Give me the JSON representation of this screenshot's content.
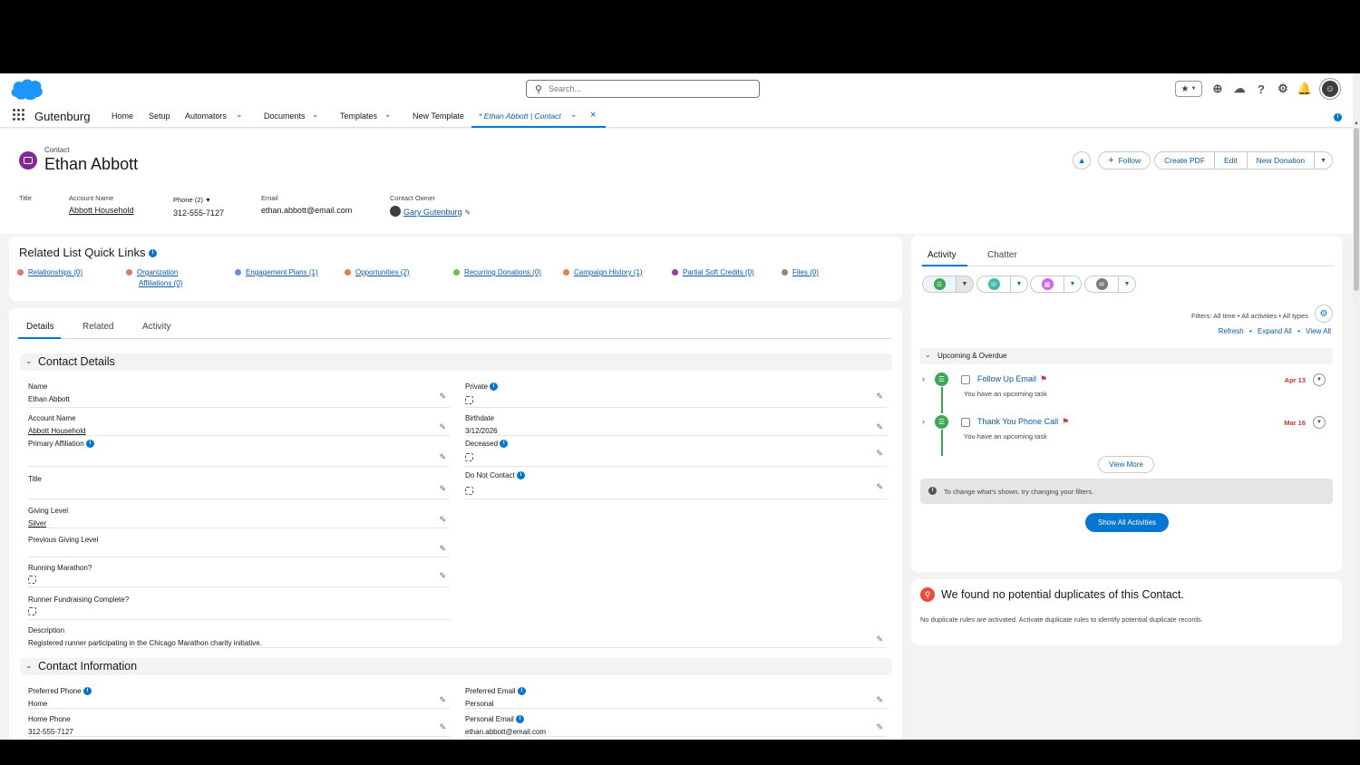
{
  "header": {
    "search_placeholder": "Search...",
    "icons": [
      "star-icon",
      "add-icon",
      "trailhead-icon",
      "help-icon",
      "setup-gear-icon",
      "bell-icon",
      "avatar-icon"
    ]
  },
  "nav": {
    "app_name": "Gutenburg",
    "items": [
      "Home",
      "Setup",
      "Automators",
      "Documents",
      "Templates",
      "New Template"
    ],
    "active_tab": "* Ethan Abbott | Contact"
  },
  "record": {
    "type": "Contact",
    "name": "Ethan Abbott",
    "buttons": {
      "follow": "Follow",
      "create_pdf": "Create PDF",
      "edit": "Edit",
      "new_donation": "New Donation"
    },
    "highlights": [
      {
        "label": "Title",
        "value": ""
      },
      {
        "label": "Account Name",
        "value": "Abbott Household"
      },
      {
        "label": "Phone (2)",
        "value": "312-555-7127"
      },
      {
        "label": "Email",
        "value": "ethan.abbott@email.com"
      },
      {
        "label": "Contact Owner",
        "value": "Gary Gutenburg"
      }
    ]
  },
  "quick_links": {
    "title": "Related List Quick Links",
    "links": [
      {
        "label": "Relationships (0)",
        "color": "#e8726b"
      },
      {
        "label": "Organization",
        "label2": "Affiliations (0)",
        "color": "#e8726b"
      },
      {
        "label": "Engagement Plans (1)",
        "color": "#6e8ad8"
      },
      {
        "label": "Opportunities (2)",
        "color": "#ec7a46"
      },
      {
        "label": "Recurring Donations (0)",
        "color": "#6cc04a"
      },
      {
        "label": "Campaign History (1)",
        "color": "#ec7a46"
      },
      {
        "label": "Partial Soft Credits (0)",
        "color": "#9b3aa8"
      },
      {
        "label": "Files (0)",
        "color": "#888888"
      }
    ]
  },
  "detail_tabs": [
    "Details",
    "Related",
    "Activity"
  ],
  "contact_details": {
    "title": "Contact Details",
    "left": [
      {
        "label": "Name",
        "value": "Ethan Abbott"
      },
      {
        "label": "Account Name",
        "value": "Abbott Household"
      },
      {
        "label": "Primary Affiliation",
        "value": ""
      },
      {
        "label": "Title",
        "value": ""
      },
      {
        "label": "Giving Level",
        "value": "Silver"
      },
      {
        "label": "Previous Giving Level",
        "value": ""
      },
      {
        "label": "Running Marathon?",
        "value": ""
      },
      {
        "label": "Runner Fundraising Complete?",
        "value": ""
      }
    ],
    "right": [
      {
        "label": "Private",
        "value": ""
      },
      {
        "label": "Birthdate",
        "value": "3/12/2026"
      },
      {
        "label": "Deceased",
        "value": ""
      },
      {
        "label": "Do Not Contact",
        "value": ""
      }
    ],
    "description_label": "Description",
    "description": "Registered runner participating in the Chicago Marathon charity initiative."
  },
  "contact_information": {
    "title": "Contact Information",
    "left": [
      {
        "label": "Preferred Phone",
        "value": "Home"
      },
      {
        "label": "Home Phone",
        "value": "312-555-7127"
      }
    ],
    "right": [
      {
        "label": "Preferred Email",
        "value": "Personal"
      },
      {
        "label": "Personal Email",
        "value": "ethan.abbott@email.com"
      }
    ]
  },
  "activity": {
    "tabs": [
      "Activity",
      "Chatter"
    ],
    "filters": "Filters: All time • All activities • All types",
    "links": [
      "Refresh",
      "Expand All",
      "View All"
    ],
    "upcoming": "Upcoming & Overdue",
    "tasks": [
      {
        "title": "Follow Up Email",
        "sub": "You have an upcoming task",
        "date": "Apr 13"
      },
      {
        "title": "Thank You Phone Call",
        "sub": "You have an upcoming task",
        "date": "Mar 16"
      }
    ],
    "view_more": "View More",
    "notice": "To change what's shown, try changing your filters.",
    "show_all": "Show All Activities"
  },
  "duplicates": {
    "title": "We found no potential duplicates of this Contact.",
    "text": "No duplicate rules are activated. Activate duplicate rules to identify potential duplicate records."
  }
}
